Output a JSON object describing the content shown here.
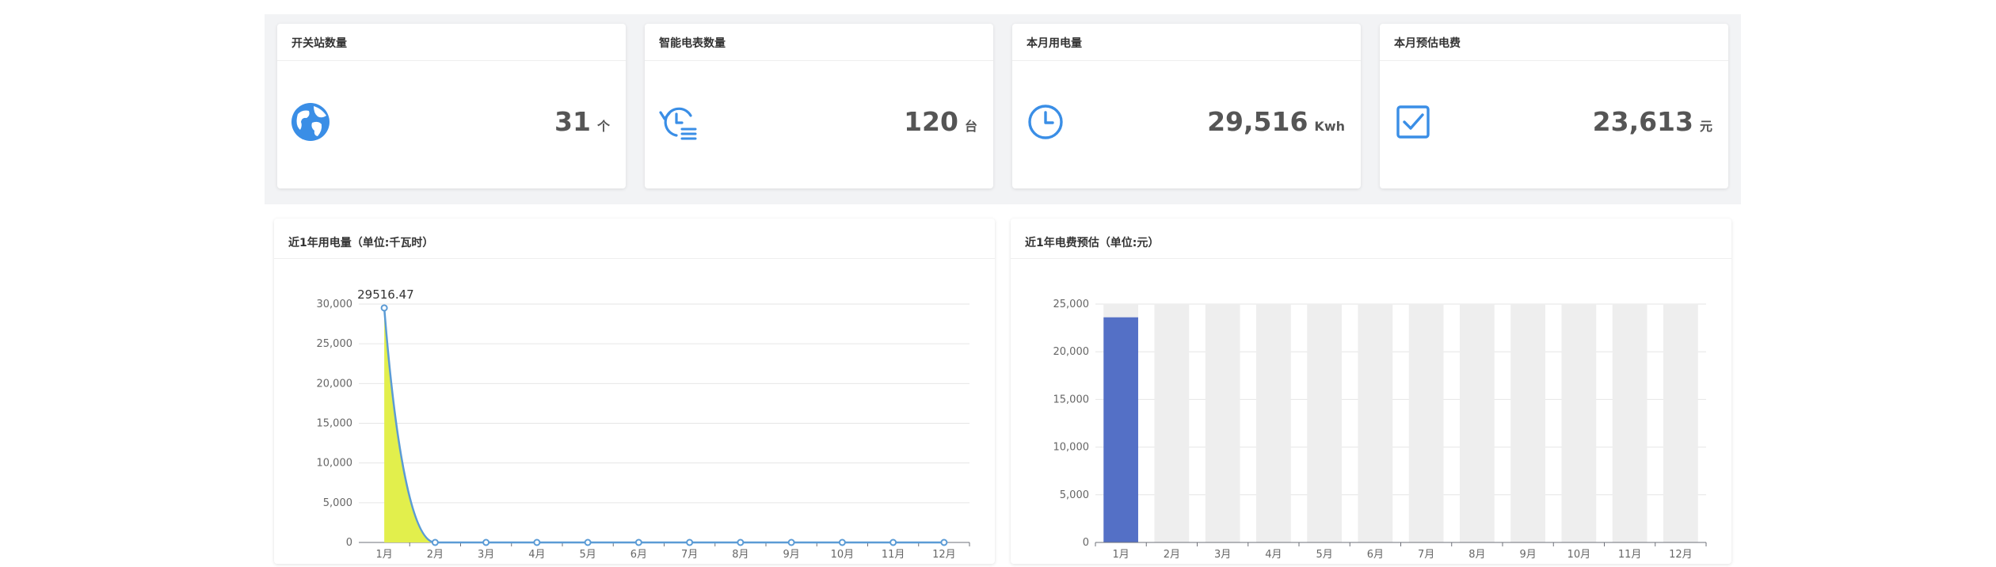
{
  "stats": [
    {
      "title": "开关站数量",
      "value": "31",
      "unit": "个",
      "icon": "globe-icon"
    },
    {
      "title": "智能电表数量",
      "value": "120",
      "unit": "台",
      "icon": "history-list-icon"
    },
    {
      "title": "本月用电量",
      "value": "29,516",
      "unit": "Kwh",
      "icon": "clock-icon"
    },
    {
      "title": "本月预估电费",
      "value": "23,613",
      "unit": "元",
      "icon": "checkbox-icon"
    }
  ],
  "colors": {
    "accent": "#3a8ee6",
    "line": "#5b9bd5",
    "area": "#e2ef4c",
    "bar": "#5470c6",
    "bar_background": "#eeeeee"
  },
  "chart_data": [
    {
      "type": "line",
      "title": "近1年用电量（单位:千瓦时）",
      "categories": [
        "1月",
        "2月",
        "3月",
        "4月",
        "5月",
        "6月",
        "7月",
        "8月",
        "9月",
        "10月",
        "11月",
        "12月"
      ],
      "values": [
        29516.47,
        0,
        0,
        0,
        0,
        0,
        0,
        0,
        0,
        0,
        0,
        0
      ],
      "data_labels": [
        "29516.47"
      ],
      "ylim": [
        0,
        30000
      ],
      "yticks": [
        "0",
        "5,000",
        "10,000",
        "15,000",
        "20,000",
        "25,000",
        "30,000"
      ],
      "grid": true,
      "smooth": true,
      "area_fill": true
    },
    {
      "type": "bar",
      "title": "近1年电费预估（单位:元）",
      "categories": [
        "1月",
        "2月",
        "3月",
        "4月",
        "5月",
        "6月",
        "7月",
        "8月",
        "9月",
        "10月",
        "11月",
        "12月"
      ],
      "values": [
        23613,
        0,
        0,
        0,
        0,
        0,
        0,
        0,
        0,
        0,
        0,
        0
      ],
      "ylim": [
        0,
        25000
      ],
      "yticks": [
        "0",
        "5,000",
        "10,000",
        "15,000",
        "20,000",
        "25,000"
      ],
      "grid": true,
      "show_background": true
    }
  ]
}
